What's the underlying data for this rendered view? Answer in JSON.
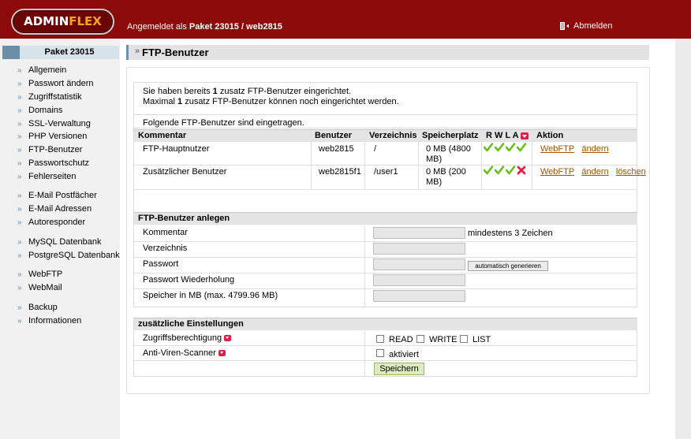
{
  "header": {
    "logo_admin": "ADMIN",
    "logo_flex": "FLEX",
    "logged_prefix": "Angemeldet als ",
    "logged_user": "Paket 23015 / web2815",
    "logout_label": "Abmelden"
  },
  "sidebar": {
    "title": "Paket 23015",
    "items": [
      {
        "label": "Allgemein"
      },
      {
        "label": "Passwort ändern"
      },
      {
        "label": "Zugriffstatistik"
      },
      {
        "label": "Domains"
      },
      {
        "label": "SSL-Verwaltung"
      },
      {
        "label": "PHP Versionen"
      },
      {
        "label": "FTP-Benutzer"
      },
      {
        "label": "Passwortschutz"
      },
      {
        "label": "Fehlerseiten"
      },
      {
        "label": "E-Mail Postfächer"
      },
      {
        "label": "E-Mail Adressen"
      },
      {
        "label": "Autoresponder"
      },
      {
        "label": "MySQL Datenbank"
      },
      {
        "label": "PostgreSQL Datenbank"
      },
      {
        "label": "WebFTP"
      },
      {
        "label": "WebMail"
      },
      {
        "label": "Backup"
      },
      {
        "label": "Informationen"
      }
    ]
  },
  "page": {
    "title": "FTP-Benutzer",
    "title_arrows": "»"
  },
  "info": {
    "line1_pre": "Sie haben bereits ",
    "line1_num": "1",
    "line1_post": " zusatz FTP-Benutzer eingerichtet.",
    "line2_pre": "Maximal ",
    "line2_num": "1",
    "line2_post": " zusatz FTP-Benutzer können noch eingerichtet werden."
  },
  "list": {
    "intro": "Folgende FTP-Benutzer sind eingetragen.",
    "headers": {
      "comment": "Kommentar",
      "user": "Benutzer",
      "directory": "Verzeichnis",
      "storage": "Speicherplatz",
      "rwla": "R W L A",
      "action": "Aktion"
    },
    "rows": [
      {
        "comment": "FTP-Hauptnutzer",
        "user": "web2815",
        "directory": "/",
        "storage_line1": "0 MB (4800",
        "storage_line2": "MB)",
        "permissions": [
          true,
          true,
          true,
          true
        ],
        "actions": {
          "webftp": "WebFTP",
          "edit": "ändern"
        }
      },
      {
        "comment": "Zusätzlicher Benutzer",
        "user": "web2815f1",
        "directory": "/user1",
        "storage_line1": "0 MB (200",
        "storage_line2": "MB)",
        "permissions": [
          true,
          true,
          true,
          false
        ],
        "actions": {
          "webftp": "WebFTP",
          "edit": "ändern",
          "delete": "löschen"
        }
      }
    ]
  },
  "create": {
    "title": "FTP-Benutzer anlegen",
    "comment_label": "Kommentar",
    "comment_hint": "mindestens 3 Zeichen",
    "dir_label": "Verzeichnis",
    "password_label": "Passwort",
    "generate_button": "automatisch generieren",
    "password_repeat_label": "Passwort Wiederholung",
    "storage_label": "Speicher in MB (max. 4799.96 MB)"
  },
  "extra": {
    "title": "zusätzliche Einstellungen",
    "access_label": "Zugriffsberechtigung",
    "read": "READ",
    "write": "WRITE",
    "list": "LIST",
    "antivirus_label": "Anti-Viren-Scanner",
    "antivirus_option": "aktiviert",
    "save_button": "Speichern"
  },
  "colors": {
    "header": "#8c0a0a",
    "accent": "#6a8fa6",
    "link": "#a35300",
    "check": "#6cbf1a",
    "cross": "#e0204a"
  }
}
